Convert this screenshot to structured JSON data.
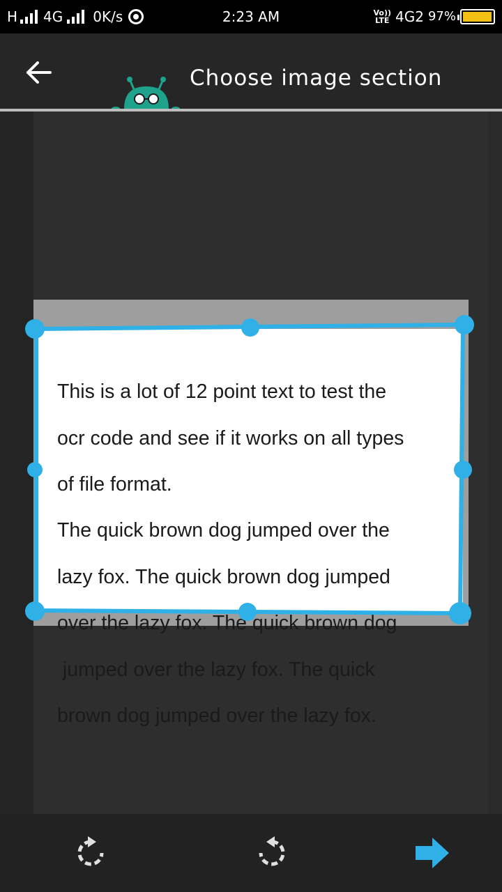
{
  "status_bar": {
    "network1": "H",
    "network2": "4G",
    "speed": "0K/s",
    "time": "2:23 AM",
    "volte_top": "Vo))",
    "volte_bottom": "LTE",
    "network3": "4G2",
    "battery_pct": "97%",
    "battery_level": 0.97,
    "battery_color": "#f2c012"
  },
  "header": {
    "title": "Choose image section",
    "back_icon": "arrow-left-icon",
    "mascot_icon": "robot-mascot-icon"
  },
  "document": {
    "text_lines": [
      "This is a lot of 12 point text to test the",
      "ocr code and see if it works on  all types",
      "of file format.",
      "The quick brown dog jumped over the",
      "lazy fox. The quick brown dog jumped",
      "over the lazy fox. The quick brown dog",
      " jumped over the lazy fox. The quick",
      "brown dog jumped over the lazy fox."
    ]
  },
  "crop": {
    "accent_color": "#2fb0e6",
    "handles": [
      "top-left",
      "top-middle",
      "top-right",
      "middle-left",
      "middle-right",
      "bottom-left",
      "bottom-middle",
      "bottom-right"
    ]
  },
  "toolbar": {
    "rotate_right_icon": "rotate-clockwise-icon",
    "rotate_left_icon": "rotate-counterclockwise-icon",
    "next_icon": "arrow-right-icon",
    "next_color": "#2fb0e6"
  }
}
